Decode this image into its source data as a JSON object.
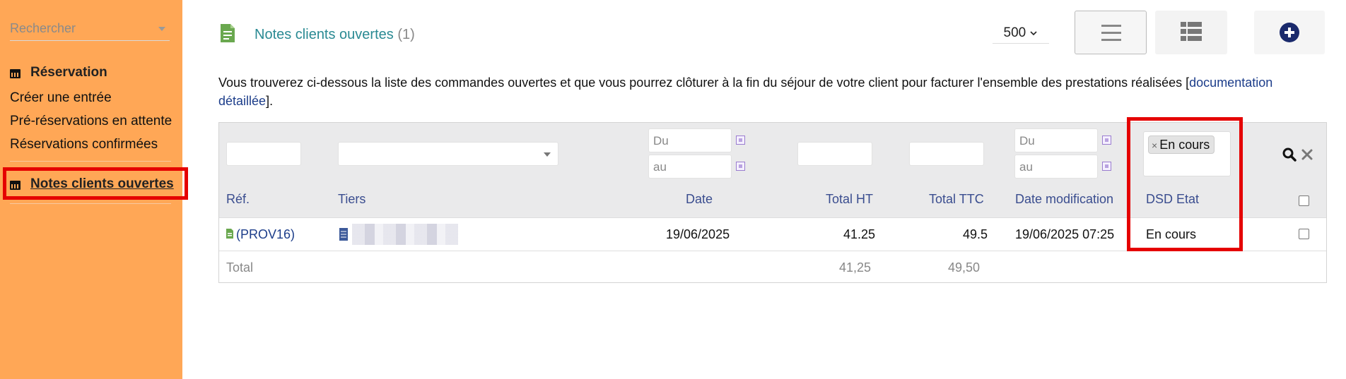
{
  "sidebar": {
    "search_placeholder": "Rechercher",
    "section_title": "Réservation",
    "items": [
      {
        "label": "Créer une entrée"
      },
      {
        "label": "Pré-réservations en attente"
      },
      {
        "label": "Réservations confirmées"
      }
    ],
    "active_item": "Notes clients ouvertes"
  },
  "header": {
    "title": "Notes clients ouvertes",
    "count": "(1)",
    "limit": "500"
  },
  "intro": {
    "text": "Vous trouverez ci-dessous la liste des commandes ouvertes et que vous pourrez clôturer à la fin du séjour de votre client pour facturer l'ensemble des prestations réalisées [",
    "link": "documentation détaillée",
    "end": "]."
  },
  "filters": {
    "date_from": "Du",
    "date_to": "au",
    "dsd_tag": "En cours"
  },
  "columns": [
    "Réf.",
    "Tiers",
    "Date",
    "Total HT",
    "Total TTC",
    "Date modification",
    "DSD Etat"
  ],
  "rows": [
    {
      "ref": "(PROV16)",
      "tiers": "",
      "date": "19/06/2025",
      "total_ht": "41.25",
      "total_ttc": "49.5",
      "date_modif": "19/06/2025 07:25",
      "etat": "En cours"
    }
  ],
  "totals": {
    "label": "Total",
    "ht": "41,25",
    "ttc": "49,50"
  },
  "colors": {
    "sidebar": "#ffa756",
    "accent": "#2a8a93",
    "highlight": "#e50000"
  }
}
